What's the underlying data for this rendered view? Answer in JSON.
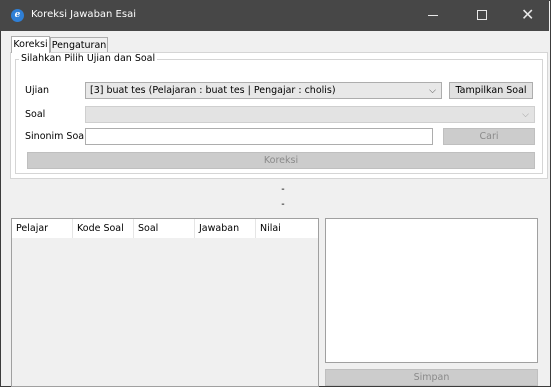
{
  "window": {
    "title": "Koreksi Jawaban Esai",
    "app_icon_glyph": "e",
    "controls": {
      "minimize": "–",
      "maximize": "☐",
      "close": "✕"
    }
  },
  "tabs": [
    {
      "label": "Koreksi",
      "active": true
    },
    {
      "label": "Pengaturan",
      "active": false
    }
  ],
  "group": {
    "title": "Silahkan Pilih Ujian dan Soal",
    "ujian_label": "Ujian",
    "ujian_value": "[3] buat tes (Pelajaran : buat tes | Pengajar : cholis)",
    "tampilkan_button": "Tampilkan Soal",
    "soal_label": "Soal",
    "soal_value": "",
    "sinonim_label": "Sinonim Soal",
    "sinonim_value": "",
    "cari_button": "Cari",
    "koreksi_button": "Koreksi"
  },
  "status": {
    "line1": "-",
    "line2": "-"
  },
  "grid": {
    "columns": [
      "Pelajar",
      "Kode Soal",
      "Soal",
      "Jawaban",
      "Nilai"
    ],
    "rows": []
  },
  "detail": {
    "text": ""
  },
  "simpan_button": "Simpan",
  "icons": {
    "app": "app-icon",
    "dropdown": "chevron-down-icon"
  },
  "colors": {
    "titlebar": "#474747",
    "window_bg": "#f0f0f0",
    "app_icon": "#2f7fd6",
    "disabled_button": "#cccccc"
  }
}
